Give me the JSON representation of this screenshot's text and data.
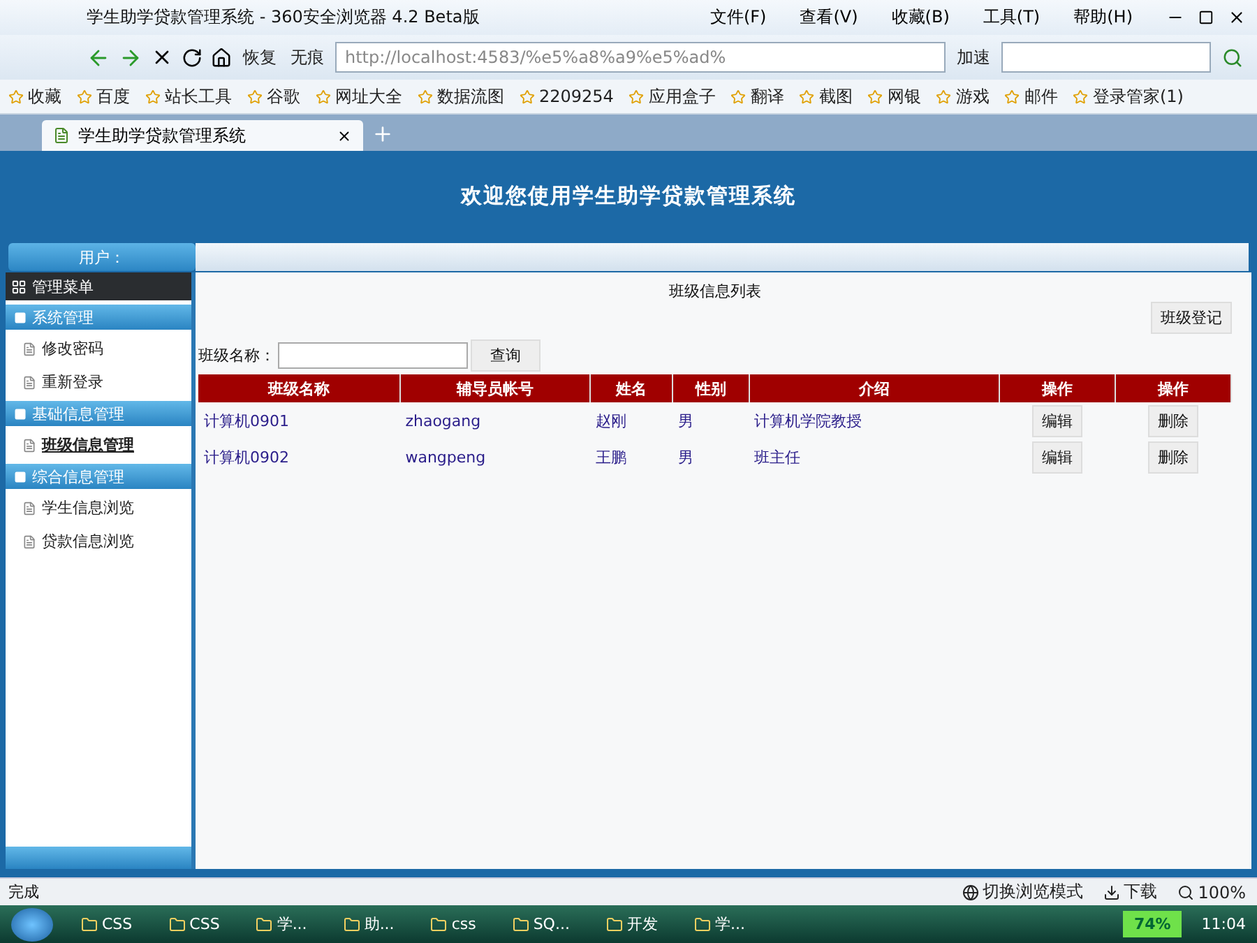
{
  "window": {
    "title": "学生助学贷款管理系统 - 360安全浏览器 4.2 Beta版"
  },
  "menu": [
    "文件(F)",
    "查看(V)",
    "收藏(B)",
    "工具(T)",
    "帮助(H)"
  ],
  "toolbar": {
    "restore": "恢复",
    "incognito": "无痕",
    "address": "http://localhost:4583/%e5%a8%a9%e5%ad%",
    "speedup": "加速"
  },
  "bookmarks": [
    "收藏",
    "百度",
    "站长工具",
    "谷歌",
    "网址大全",
    "数据流图",
    "2209254",
    "应用盒子",
    "翻译",
    "截图",
    "网银",
    "游戏",
    "邮件",
    "登录管家(1)"
  ],
  "tabs": [
    {
      "label": "学生助学贷款管理系统",
      "selected": true
    }
  ],
  "page": {
    "banner": "欢迎您使用学生助学贷款管理系统",
    "user_label": "用户：",
    "sidebar": {
      "title": "管理菜单",
      "groups": [
        {
          "label": "系统管理",
          "items": [
            {
              "label": "修改密码",
              "selected": false
            },
            {
              "label": "重新登录",
              "selected": false
            }
          ]
        },
        {
          "label": "基础信息管理",
          "items": [
            {
              "label": "班级信息管理",
              "selected": true
            }
          ]
        },
        {
          "label": "综合信息管理",
          "items": [
            {
              "label": "学生信息浏览",
              "selected": false
            },
            {
              "label": "贷款信息浏览",
              "selected": false
            }
          ]
        }
      ]
    },
    "list_title": "班级信息列表",
    "register_button": "班级登记",
    "search": {
      "label": "班级名称：",
      "button": "查询"
    },
    "table": {
      "columns": [
        "班级名称",
        "辅导员帐号",
        "姓名",
        "性别",
        "介绍",
        "操作",
        "操作"
      ],
      "rows": [
        {
          "cells": [
            "计算机0901",
            "zhaogang",
            "赵刚",
            "男",
            "计算机学院教授"
          ],
          "actions": [
            "编辑",
            "删除"
          ]
        },
        {
          "cells": [
            "计算机0902",
            "wangpeng",
            "王鹏",
            "男",
            "班主任"
          ],
          "actions": [
            "编辑",
            "删除"
          ]
        }
      ]
    }
  },
  "status_bar": {
    "text": "完成",
    "mode": "切换浏览模式",
    "download": "下载",
    "zoom": "100%"
  },
  "taskbar": {
    "items": [
      "CSS",
      "CSS",
      "学...",
      "助...",
      "css",
      "SQ...",
      "开发",
      "学..."
    ],
    "meter": "74%",
    "clock": "11:04"
  }
}
